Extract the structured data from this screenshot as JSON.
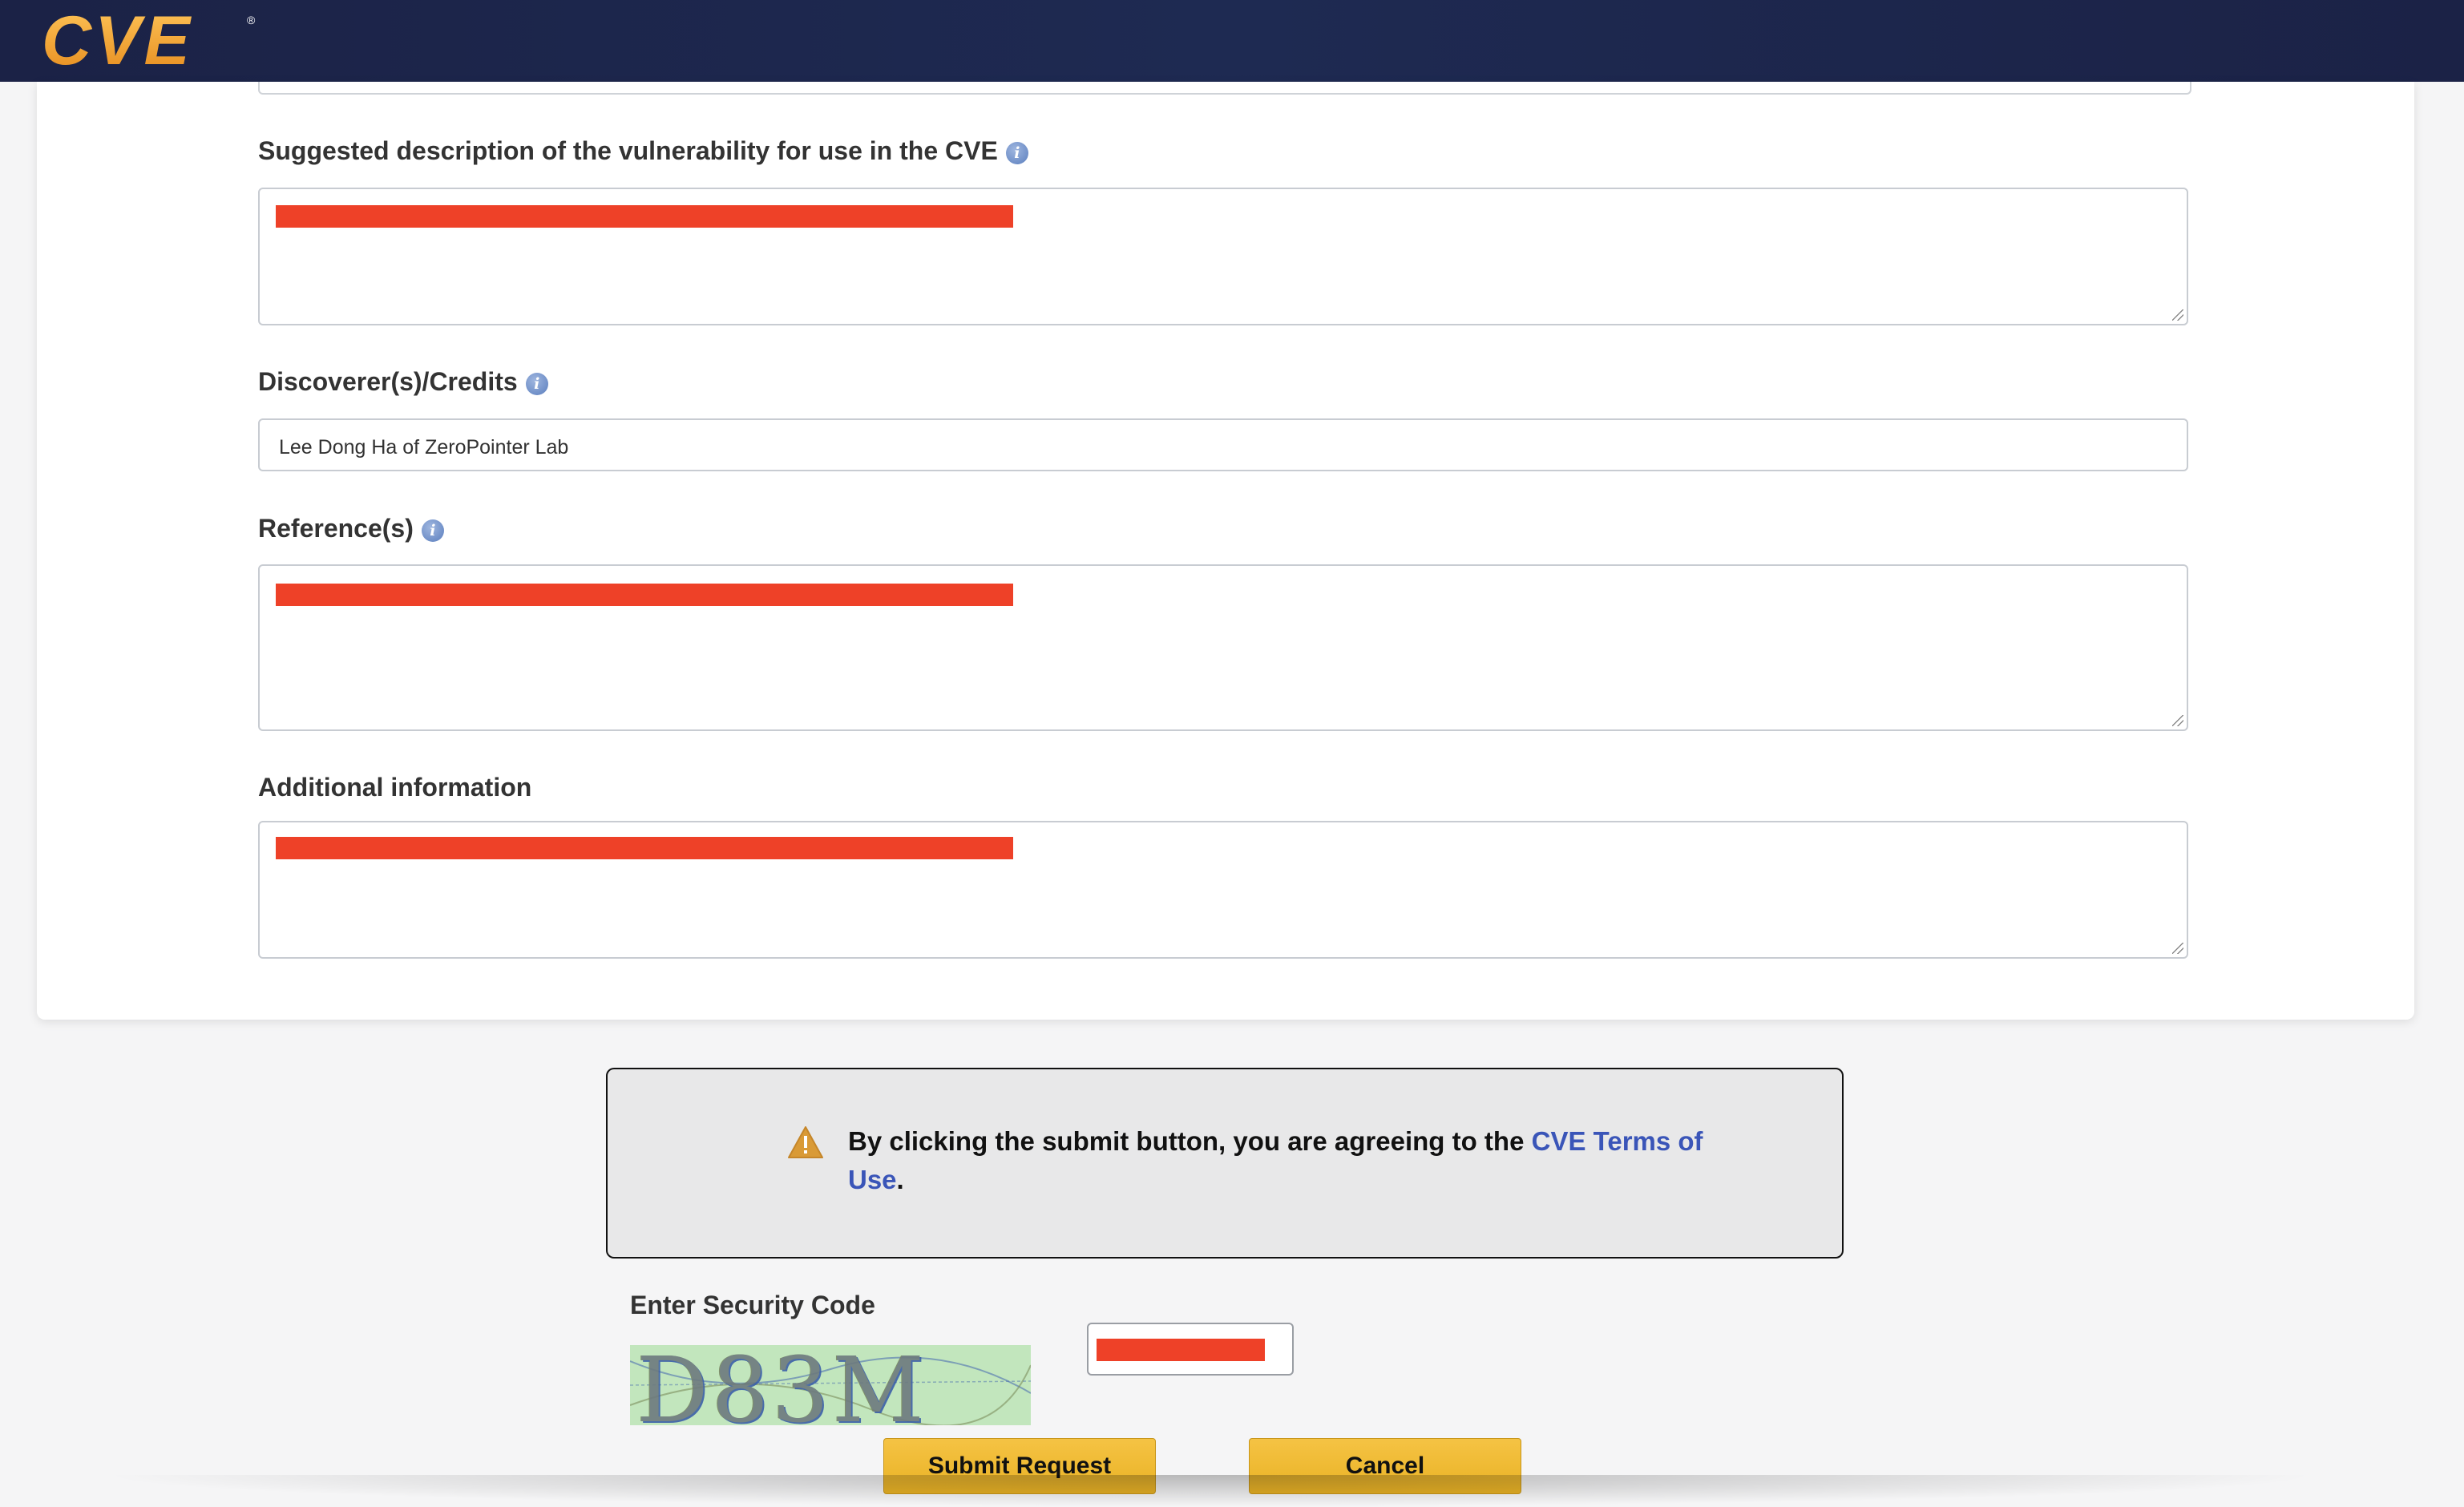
{
  "header": {
    "logo_text": "CVE",
    "logo_mark": "®"
  },
  "form": {
    "description_label": "Suggested description of the vulnerability for use in the CVE",
    "credits_label": "Discoverer(s)/Credits",
    "credits_value": "Lee Dong Ha of ZeroPointer Lab",
    "references_label": "Reference(s)",
    "additional_label": "Additional information",
    "info_icon_glyph": "i"
  },
  "notice": {
    "text_before": "By clicking the submit button, you are agreeing to the ",
    "link_text": "CVE Terms of Use",
    "text_after": "."
  },
  "security": {
    "label": "Enter Security Code",
    "captcha_text": "D83M"
  },
  "buttons": {
    "submit": "Submit Request",
    "cancel": "Cancel"
  },
  "colors": {
    "header_bg": "#1b2246",
    "logo_orange": "#f0a53a",
    "redaction": "#ee4128",
    "button_yellow": "#f0bb33",
    "link_blue": "#3a55b8"
  }
}
